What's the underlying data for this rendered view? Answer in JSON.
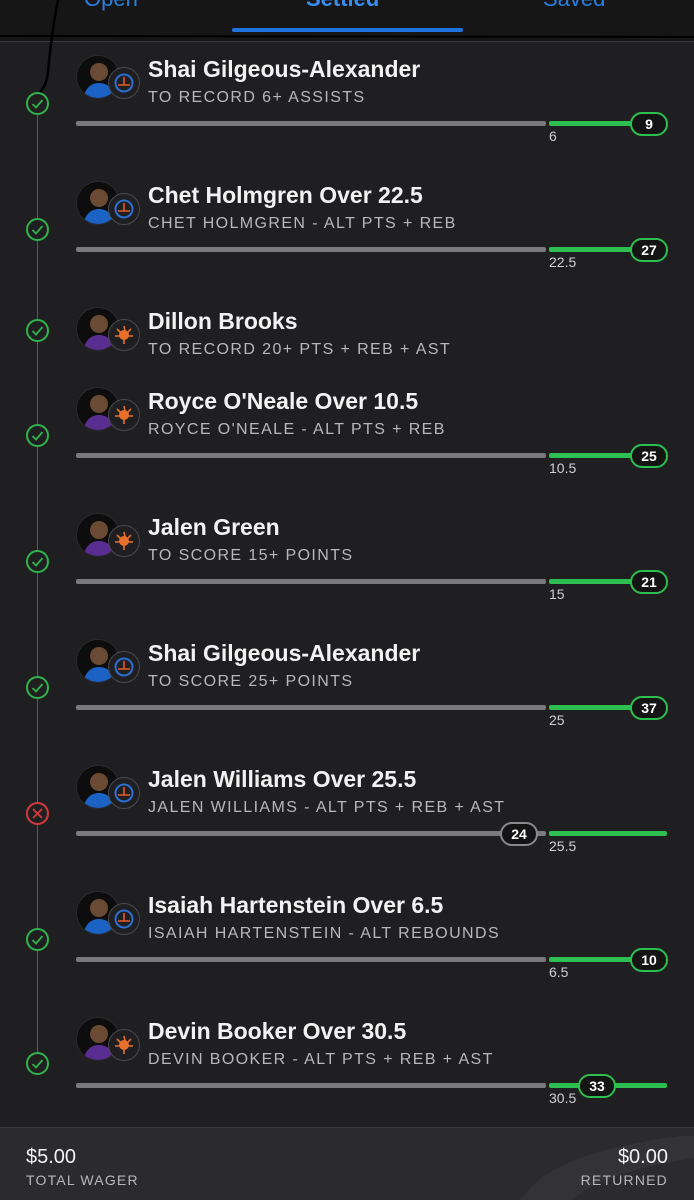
{
  "tabs": {
    "open": "Open",
    "settled": "Settled",
    "saved": "Saved"
  },
  "colors": {
    "accent": "#1e73e0",
    "won": "#2dbf4f",
    "lost": "#d33a3f"
  },
  "legs": [
    {
      "title": "Shai Gilgeous-Alexander",
      "subtitle": "TO RECORD 6+ ASSISTS",
      "team": "OKC",
      "status": "won",
      "line": "6",
      "result": "9",
      "has_progress": true
    },
    {
      "title": "Chet Holmgren Over 22.5",
      "subtitle": "CHET HOLMGREN - ALT PTS + REB",
      "team": "OKC",
      "status": "won",
      "line": "22.5",
      "result": "27",
      "has_progress": true
    },
    {
      "title": "Dillon Brooks",
      "subtitle": "TO RECORD 20+ PTS + REB + AST",
      "team": "PHX",
      "status": "won",
      "has_progress": false
    },
    {
      "title": "Royce O'Neale Over 10.5",
      "subtitle": "ROYCE O'NEALE - ALT PTS + REB",
      "team": "PHX",
      "status": "won",
      "line": "10.5",
      "result": "25",
      "has_progress": true
    },
    {
      "title": "Jalen Green",
      "subtitle": "TO SCORE 15+ POINTS",
      "team": "PHX",
      "status": "won",
      "line": "15",
      "result": "21",
      "has_progress": true
    },
    {
      "title": "Shai Gilgeous-Alexander",
      "subtitle": "TO SCORE 25+ POINTS",
      "team": "OKC",
      "status": "won",
      "line": "25",
      "result": "37",
      "has_progress": true
    },
    {
      "title": "Jalen Williams Over 25.5",
      "subtitle": "JALEN WILLIAMS - ALT PTS + REB + AST",
      "team": "OKC",
      "status": "lost",
      "line": "25.5",
      "result": "24",
      "has_progress": true
    },
    {
      "title": "Isaiah Hartenstein Over 6.5",
      "subtitle": "ISAIAH HARTENSTEIN - ALT REBOUNDS",
      "team": "OKC",
      "status": "won",
      "line": "6.5",
      "result": "10",
      "has_progress": true
    },
    {
      "title": "Devin Booker Over 30.5",
      "subtitle": "DEVIN BOOKER - ALT PTS + REB + AST",
      "team": "PHX",
      "status": "won",
      "line": "30.5",
      "result": "33",
      "has_progress": true
    }
  ],
  "footer": {
    "wager_amount": "$5.00",
    "wager_label": "TOTAL WAGER",
    "returned_amount": "$0.00",
    "returned_label": "RETURNED"
  }
}
